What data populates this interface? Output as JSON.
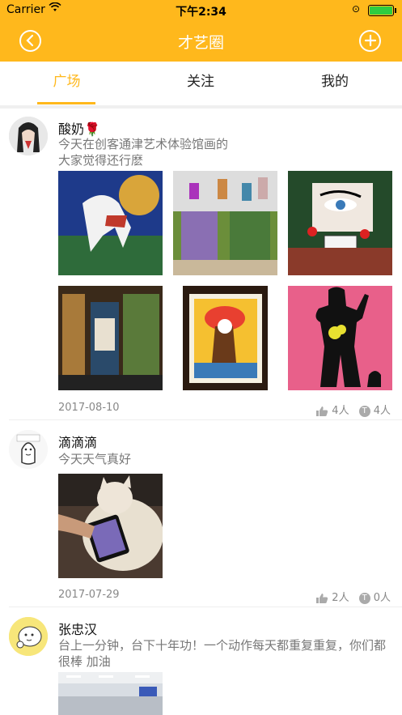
{
  "status_bar": {
    "carrier": "Carrier",
    "time": "下午2:34"
  },
  "nav": {
    "title": "才艺圈"
  },
  "tabs": [
    {
      "label": "广场"
    },
    {
      "label": "关注"
    },
    {
      "label": "我的"
    }
  ],
  "posts": [
    {
      "name": "酸奶",
      "emoji": "🌹",
      "text": "今天在创客通津艺术体验馆画的\n大家觉得还行麽",
      "date": "2017-08-10",
      "likes": "4人",
      "comments": "4人"
    },
    {
      "name": "滴滴滴",
      "text": "今天天气真好",
      "date": "2017-07-29",
      "likes": "2人",
      "comments": "0人"
    },
    {
      "name": "张忠汉",
      "text": "台上一分钟，台下十年功！一个动作每天都重复重复，你们都很棒 加油"
    }
  ],
  "colors": {
    "accent": "#FFB81C"
  },
  "icons": {
    "back": "back-icon",
    "add": "add-icon",
    "like": "thumb-up-icon",
    "comment": "comment-icon"
  }
}
